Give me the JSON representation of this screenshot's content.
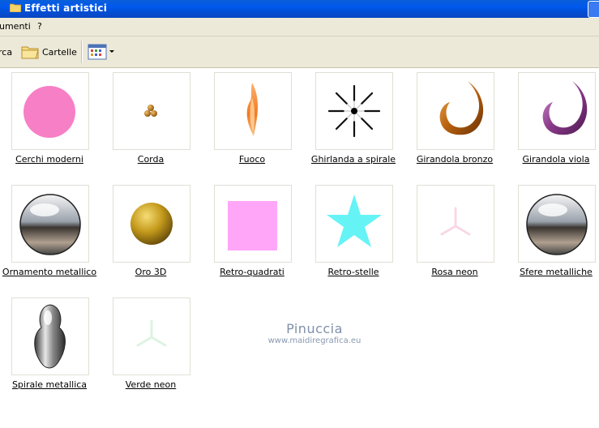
{
  "window": {
    "title": "Effetti artistici"
  },
  "menu": {
    "items": [
      "umenti",
      "?"
    ]
  },
  "toolbar": {
    "search_label": "rca",
    "folders_label": "Cartelle"
  },
  "items": [
    {
      "label": "Cerchi moderni"
    },
    {
      "label": "Corda"
    },
    {
      "label": "Fuoco"
    },
    {
      "label": "Ghirlanda a spirale"
    },
    {
      "label": "Girandola bronzo"
    },
    {
      "label": "Girandola viola"
    },
    {
      "label": "Ornamento metallico"
    },
    {
      "label": "Oro 3D"
    },
    {
      "label": "Retro-quadrati"
    },
    {
      "label": "Retro-stelle"
    },
    {
      "label": "Rosa neon"
    },
    {
      "label": "Sfere metalliche"
    },
    {
      "label": "Spirale metallica"
    },
    {
      "label": "Verde neon"
    }
  ],
  "watermark": {
    "name": "Pinuccia",
    "url": "www.maidiregrafica.eu"
  },
  "colors": {
    "titlebar": "#0058ee",
    "chrome": "#ece9d8",
    "pink": "#f77fc6",
    "cyan": "#66f3f6",
    "retro_square": "#ffa6f8"
  }
}
